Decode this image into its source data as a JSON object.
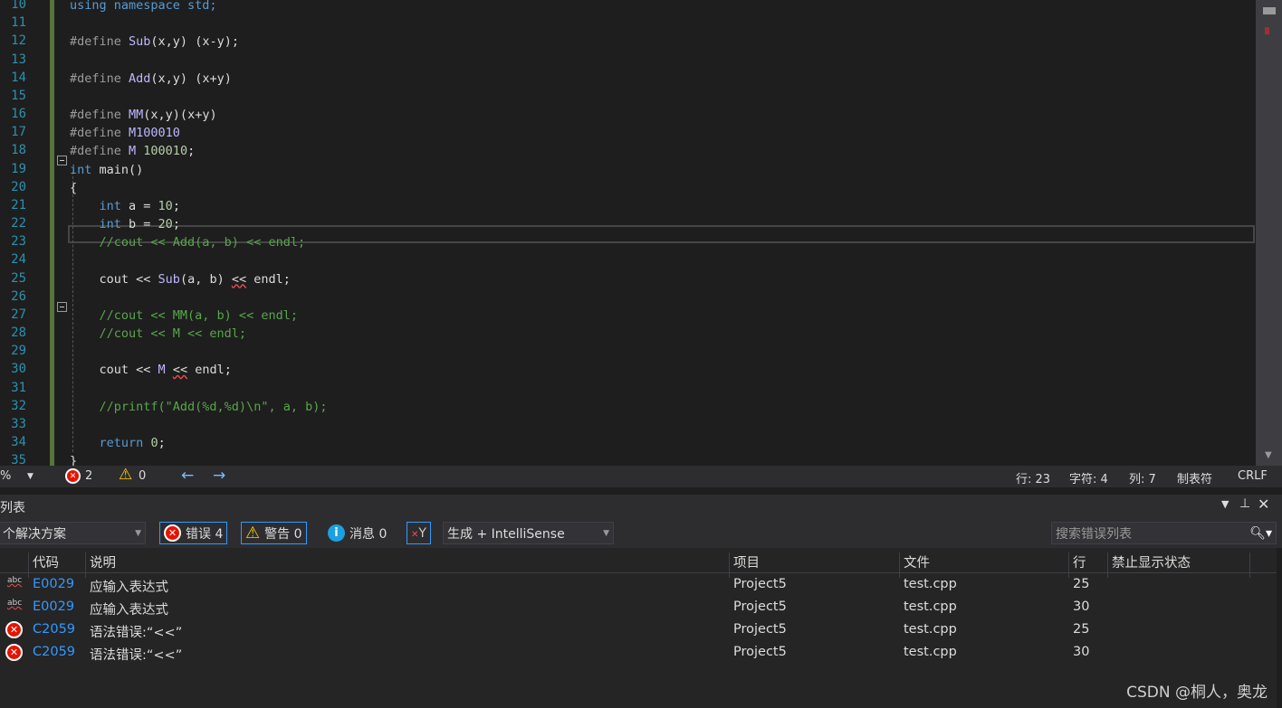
{
  "editor": {
    "lines": [
      {
        "no": "10",
        "tok": [
          [
            "k",
            "using namespace std;"
          ]
        ]
      },
      {
        "no": "11",
        "tok": []
      },
      {
        "no": "12",
        "tok": [
          [
            "p",
            "#define "
          ],
          [
            "m",
            "Sub"
          ],
          [
            "t",
            "(x,y) (x-y);"
          ]
        ]
      },
      {
        "no": "13",
        "tok": []
      },
      {
        "no": "14",
        "tok": [
          [
            "p",
            "#define "
          ],
          [
            "m",
            "Add"
          ],
          [
            "t",
            "(x,y) (x+y)"
          ]
        ]
      },
      {
        "no": "15",
        "tok": []
      },
      {
        "no": "16",
        "tok": [
          [
            "p",
            "#define "
          ],
          [
            "m",
            "MM"
          ],
          [
            "t",
            "(x,y)(x+y)"
          ]
        ]
      },
      {
        "no": "17",
        "tok": [
          [
            "p",
            "#define "
          ],
          [
            "m",
            "M100010"
          ]
        ]
      },
      {
        "no": "18",
        "tok": [
          [
            "p",
            "#define "
          ],
          [
            "m",
            "M"
          ],
          [
            "n",
            " 100010"
          ],
          [
            "t",
            ";"
          ]
        ]
      },
      {
        "no": "19",
        "tok": [
          [
            "k",
            "int"
          ],
          [
            "t",
            " main()"
          ]
        ]
      },
      {
        "no": "20",
        "tok": [
          [
            "t",
            "{"
          ]
        ]
      },
      {
        "no": "21",
        "tok": [
          [
            "t",
            "    "
          ],
          [
            "k",
            "int"
          ],
          [
            "t",
            " a = "
          ],
          [
            "n",
            "10"
          ],
          [
            "t",
            ";"
          ]
        ]
      },
      {
        "no": "22",
        "tok": [
          [
            "t",
            "    "
          ],
          [
            "k",
            "int"
          ],
          [
            "t",
            " b = "
          ],
          [
            "n",
            "20"
          ],
          [
            "t",
            ";"
          ]
        ]
      },
      {
        "no": "23",
        "tok": [
          [
            "c",
            "    //cout << Add(a, b) << endl;"
          ]
        ]
      },
      {
        "no": "24",
        "tok": []
      },
      {
        "no": "25",
        "tok": [
          [
            "t",
            "    cout << "
          ],
          [
            "m",
            "Sub"
          ],
          [
            "t",
            "(a, b) "
          ],
          [
            "sq",
            "<<"
          ],
          [
            "t",
            " endl;"
          ]
        ]
      },
      {
        "no": "26",
        "tok": []
      },
      {
        "no": "27",
        "tok": [
          [
            "c",
            "    //cout << MM(a, b) << endl;"
          ]
        ]
      },
      {
        "no": "28",
        "tok": [
          [
            "c",
            "    //cout << M << endl;"
          ]
        ]
      },
      {
        "no": "29",
        "tok": []
      },
      {
        "no": "30",
        "tok": [
          [
            "t",
            "    cout << "
          ],
          [
            "m",
            "M"
          ],
          [
            "t",
            " "
          ],
          [
            "sq",
            "<<"
          ],
          [
            "t",
            " endl;"
          ]
        ]
      },
      {
        "no": "31",
        "tok": []
      },
      {
        "no": "32",
        "tok": [
          [
            "c",
            "    //printf(\"Add(%d,%d)\\n\", a, b);"
          ]
        ]
      },
      {
        "no": "33",
        "tok": []
      },
      {
        "no": "34",
        "tok": [
          [
            "t",
            "    "
          ],
          [
            "k",
            "return"
          ],
          [
            "t",
            " "
          ],
          [
            "n",
            "0"
          ],
          [
            "t",
            ";"
          ]
        ]
      },
      {
        "no": "35",
        "tok": [
          [
            "t",
            "}"
          ]
        ]
      }
    ]
  },
  "status": {
    "zoom": "%",
    "errors": "2",
    "warnings": "0",
    "line": "行: 23",
    "char": "字符: 4",
    "col": "列: 7",
    "tabs": "制表符",
    "eol": "CRLF"
  },
  "panel": {
    "title": "列表",
    "scope": "个解决方案",
    "errors": "错误 4",
    "warnings": "警告 0",
    "messages": "消息 0",
    "source": "生成 + IntelliSense",
    "search_placeholder": "搜索错误列表"
  },
  "columns": {
    "code": "代码",
    "desc": "说明",
    "project": "项目",
    "file": "文件",
    "line": "行",
    "suppress": "禁止显示状态"
  },
  "rows": [
    {
      "icon": "abc-squiggle",
      "code": "E0029",
      "desc": "应输入表达式",
      "project": "Project5",
      "file": "test.cpp",
      "line": "25"
    },
    {
      "icon": "abc-squiggle",
      "code": "E0029",
      "desc": "应输入表达式",
      "project": "Project5",
      "file": "test.cpp",
      "line": "30"
    },
    {
      "icon": "error-circle",
      "code": "C2059",
      "desc": "语法错误:“<<”",
      "project": "Project5",
      "file": "test.cpp",
      "line": "25"
    },
    {
      "icon": "error-circle",
      "code": "C2059",
      "desc": "语法错误:“<<”",
      "project": "Project5",
      "file": "test.cpp",
      "line": "30"
    }
  ],
  "watermark": "CSDN @桐人，奥龙"
}
